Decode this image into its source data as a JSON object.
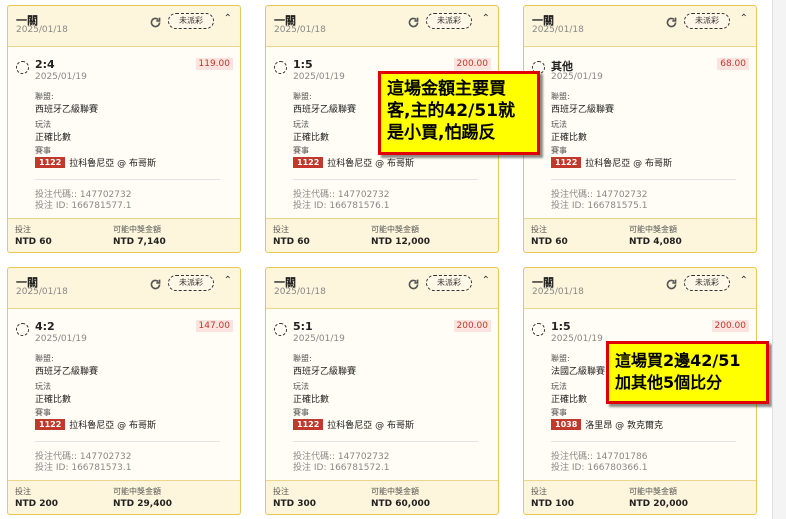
{
  "cards": [
    {
      "title": "一關",
      "date": "2025/01/18",
      "status": "未派彩",
      "pick": "2:4",
      "pick_date": "2025/01/19",
      "odds": "119.00",
      "league_label": "聯盟:",
      "league": "西班牙乙級聯賽",
      "market_label": "玩法",
      "market": "正確比數",
      "match_label": "賽事",
      "match_id": "1122",
      "match_name": "拉科魯尼亞 @ 布哥斯",
      "bet_code": "投注代碼:: 147702732",
      "bet_id": "投注 ID: 166781577.1",
      "stake_label": "投注",
      "stake": "NTD 60",
      "payout_label": "可能中獎金額",
      "payout": "NTD 7,140"
    },
    {
      "title": "一關",
      "date": "2025/01/18",
      "status": "未派彩",
      "pick": "1:5",
      "pick_date": "2025/01/19",
      "odds": "200.00",
      "league_label": "聯盟:",
      "league": "西班牙乙級聯賽",
      "market_label": "玩法",
      "market": "正確比數",
      "match_label": "賽事",
      "match_id": "1122",
      "match_name": "拉科魯尼亞 @ 布哥斯",
      "bet_code": "投注代碼:: 147702732",
      "bet_id": "投注 ID: 166781576.1",
      "stake_label": "投注",
      "stake": "NTD 60",
      "payout_label": "可能中獎金額",
      "payout": "NTD 12,000"
    },
    {
      "title": "一關",
      "date": "2025/01/18",
      "status": "未派彩",
      "pick": "其他",
      "pick_date": "2025/01/19",
      "odds": "68.00",
      "league_label": "聯盟:",
      "league": "西班牙乙級聯賽",
      "market_label": "玩法",
      "market": "正確比數",
      "match_label": "賽事",
      "match_id": "1122",
      "match_name": "拉科魯尼亞 @ 布哥斯",
      "bet_code": "投注代碼:: 147702732",
      "bet_id": "投注 ID: 166781575.1",
      "stake_label": "投注",
      "stake": "NTD 60",
      "payout_label": "可能中獎金額",
      "payout": "NTD 4,080"
    },
    {
      "title": "一關",
      "date": "2025/01/18",
      "status": "未派彩",
      "pick": "4:2",
      "pick_date": "2025/01/19",
      "odds": "147.00",
      "league_label": "聯盟:",
      "league": "西班牙乙級聯賽",
      "market_label": "玩法",
      "market": "正確比數",
      "match_label": "賽事",
      "match_id": "1122",
      "match_name": "拉科魯尼亞 @ 布哥斯",
      "bet_code": "投注代碼:: 147702732",
      "bet_id": "投注 ID: 166781573.1",
      "stake_label": "投注",
      "stake": "NTD 200",
      "payout_label": "可能中獎金額",
      "payout": "NTD 29,400"
    },
    {
      "title": "一關",
      "date": "2025/01/18",
      "status": "未派彩",
      "pick": "5:1",
      "pick_date": "2025/01/19",
      "odds": "200.00",
      "league_label": "聯盟:",
      "league": "西班牙乙級聯賽",
      "market_label": "玩法",
      "market": "正確比數",
      "match_label": "賽事",
      "match_id": "1122",
      "match_name": "拉科魯尼亞 @ 布哥斯",
      "bet_code": "投注代碼:: 147702732",
      "bet_id": "投注 ID: 166781572.1",
      "stake_label": "投注",
      "stake": "NTD 300",
      "payout_label": "可能中獎金額",
      "payout": "NTD 60,000"
    },
    {
      "title": "一關",
      "date": "2025/01/18",
      "status": "未派彩",
      "pick": "1:5",
      "pick_date": "2025/01/19",
      "odds": "200.00",
      "league_label": "聯盟:",
      "league": "法國乙級聯賽",
      "market_label": "玩法",
      "market": "正確比數",
      "match_label": "賽事",
      "match_id": "1038",
      "match_name": "洛里昂 @ 敦克爾克",
      "bet_code": "投注代碼:: 147701786",
      "bet_id": "投注 ID: 166780366.1",
      "stake_label": "投注",
      "stake": "NTD 100",
      "payout_label": "可能中獎金額",
      "payout": "NTD 20,000"
    }
  ],
  "notes": {
    "note1": [
      "這場金額主要買",
      "客,主的42/51就",
      "是小買,怕踢反"
    ],
    "note2": [
      "這場買2邊42/51",
      "加其他5個比分"
    ]
  },
  "colors": {
    "card_bg": "#fdf6dc",
    "card_border": "#e8c65a",
    "match_id_bg": "#c0392b",
    "odds_text": "#c0392b",
    "note_bg": "#ffff00",
    "note_border": "#e10000"
  }
}
